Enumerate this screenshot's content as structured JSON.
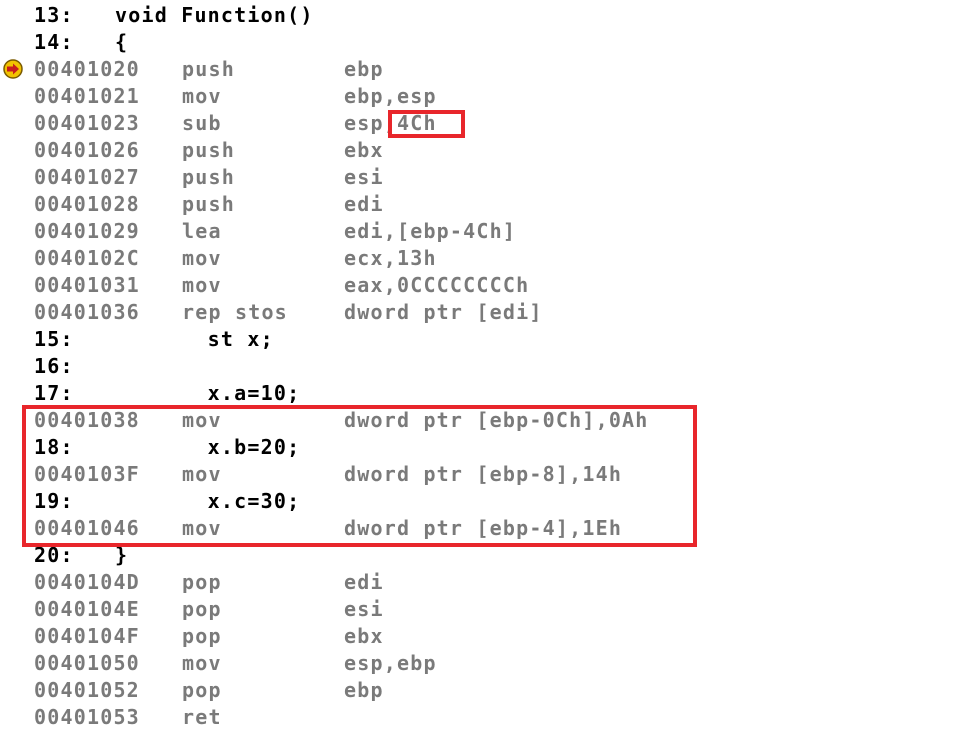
{
  "header": {
    "num": "13:",
    "code": "void Function()"
  },
  "lines": [
    {
      "kind": "src",
      "num": "14:",
      "code": "{"
    },
    {
      "kind": "asm",
      "addr": "00401020",
      "mnem": "push",
      "ops": "ebp",
      "current": true
    },
    {
      "kind": "asm",
      "addr": "00401021",
      "mnem": "mov",
      "ops": "ebp,esp"
    },
    {
      "kind": "asm",
      "addr": "00401023",
      "mnem": "sub",
      "ops": "esp,4Ch"
    },
    {
      "kind": "asm",
      "addr": "00401026",
      "mnem": "push",
      "ops": "ebx"
    },
    {
      "kind": "asm",
      "addr": "00401027",
      "mnem": "push",
      "ops": "esi"
    },
    {
      "kind": "asm",
      "addr": "00401028",
      "mnem": "push",
      "ops": "edi"
    },
    {
      "kind": "asm",
      "addr": "00401029",
      "mnem": "lea",
      "ops": "edi,[ebp-4Ch]"
    },
    {
      "kind": "asm",
      "addr": "0040102C",
      "mnem": "mov",
      "ops": "ecx,13h"
    },
    {
      "kind": "asm",
      "addr": "00401031",
      "mnem": "mov",
      "ops": "eax,0CCCCCCCCh"
    },
    {
      "kind": "asm",
      "addr": "00401036",
      "mnem": "rep stos",
      "ops": "dword ptr [edi]"
    },
    {
      "kind": "src",
      "num": "15:",
      "code": "       st x;"
    },
    {
      "kind": "src",
      "num": "16:",
      "code": ""
    },
    {
      "kind": "src",
      "num": "17:",
      "code": "       x.a=10;"
    },
    {
      "kind": "asm",
      "addr": "00401038",
      "mnem": "mov",
      "ops": "dword ptr [ebp-0Ch],0Ah"
    },
    {
      "kind": "src",
      "num": "18:",
      "code": "       x.b=20;"
    },
    {
      "kind": "asm",
      "addr": "0040103F",
      "mnem": "mov",
      "ops": "dword ptr [ebp-8],14h"
    },
    {
      "kind": "src",
      "num": "19:",
      "code": "       x.c=30;"
    },
    {
      "kind": "asm",
      "addr": "00401046",
      "mnem": "mov",
      "ops": "dword ptr [ebp-4],1Eh"
    },
    {
      "kind": "src",
      "num": "20:",
      "code": "}"
    },
    {
      "kind": "asm",
      "addr": "0040104D",
      "mnem": "pop",
      "ops": "edi"
    },
    {
      "kind": "asm",
      "addr": "0040104E",
      "mnem": "pop",
      "ops": "esi"
    },
    {
      "kind": "asm",
      "addr": "0040104F",
      "mnem": "pop",
      "ops": "ebx"
    },
    {
      "kind": "asm",
      "addr": "00401050",
      "mnem": "mov",
      "ops": "esp,ebp"
    },
    {
      "kind": "asm",
      "addr": "00401052",
      "mnem": "pop",
      "ops": "ebp"
    },
    {
      "kind": "asm",
      "addr": "00401053",
      "mnem": "ret",
      "ops": ""
    }
  ],
  "colors": {
    "source_text": "#000000",
    "disassembly_text": "#7a7a7a",
    "highlight_box": "#e8262b",
    "arrow_fill": "#f2c200"
  },
  "icons": {
    "current_line": "instruction-pointer-arrow-icon"
  }
}
